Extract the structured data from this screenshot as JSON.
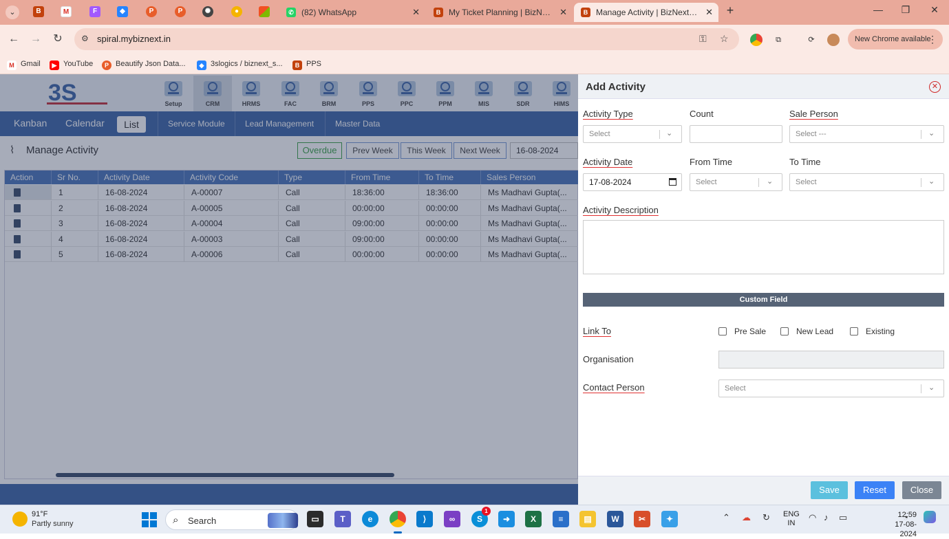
{
  "browser": {
    "tabs": [
      {
        "title": "(82) WhatsApp",
        "active": false
      },
      {
        "title": "My Ticket Planning | BizNext - A",
        "active": false
      },
      {
        "title": "Manage Activity | BizNext - An I",
        "active": true
      }
    ],
    "url": "spiral.mybiznext.in",
    "new_chrome": "New Chrome available",
    "bookmarks": [
      {
        "label": "Gmail",
        "icon": "gmail-icon",
        "color": "#d93025"
      },
      {
        "label": "YouTube",
        "icon": "youtube-icon",
        "color": "#ff0000"
      },
      {
        "label": "Beautify Json Data...",
        "icon": "p-icon",
        "color": "#e85d2a"
      },
      {
        "label": "3slogics / biznext_s...",
        "icon": "bitbucket-icon",
        "color": "#2684ff"
      },
      {
        "label": "PPS",
        "icon": "biznext-icon",
        "color": "#c2410c"
      }
    ]
  },
  "app": {
    "modules": [
      "Setup",
      "CRM",
      "HRMS",
      "FAC",
      "BRM",
      "PPS",
      "PPC",
      "PPM",
      "MIS",
      "SDR",
      "HIMS"
    ],
    "active_module": "CRM",
    "views": [
      "Kanban",
      "Calendar",
      "List"
    ],
    "active_view": "List",
    "sub_links": [
      "Service Module",
      "Lead Management",
      "Master Data"
    ],
    "page_title": "Manage Activity",
    "week_buttons": {
      "overdue": "Overdue",
      "prev": "Prev Week",
      "this": "This Week",
      "next": "Next Week"
    },
    "date_filter": "16-08-2024",
    "grid": {
      "columns": [
        "Action",
        "Sr No.",
        "Activity Date",
        "Activity Code",
        "Type",
        "From Time",
        "To Time",
        "Sales Person"
      ],
      "rows": [
        {
          "sr": "1",
          "date": "16-08-2024",
          "code": "A-00007",
          "type": "Call",
          "from": "18:36:00",
          "to": "18:36:00",
          "person": "Ms Madhavi Gupta(..."
        },
        {
          "sr": "2",
          "date": "16-08-2024",
          "code": "A-00005",
          "type": "Call",
          "from": "00:00:00",
          "to": "00:00:00",
          "person": "Ms Madhavi Gupta(..."
        },
        {
          "sr": "3",
          "date": "16-08-2024",
          "code": "A-00004",
          "type": "Call",
          "from": "09:00:00",
          "to": "00:00:00",
          "person": "Ms Madhavi Gupta(..."
        },
        {
          "sr": "4",
          "date": "16-08-2024",
          "code": "A-00003",
          "type": "Call",
          "from": "09:00:00",
          "to": "00:00:00",
          "person": "Ms Madhavi Gupta(..."
        },
        {
          "sr": "5",
          "date": "16-08-2024",
          "code": "A-00006",
          "type": "Call",
          "from": "00:00:00",
          "to": "00:00:00",
          "person": "Ms Madhavi Gupta(..."
        }
      ]
    }
  },
  "drawer": {
    "title": "Add Activity",
    "labels": {
      "activity_type": "Activity Type",
      "count": "Count",
      "sale_person": "Sale Person",
      "activity_date": "Activity Date",
      "from_time": "From Time",
      "to_time": "To Time",
      "activity_description": "Activity Description",
      "link_to": "Link To",
      "organisation": "Organisation",
      "contact_person": "Contact Person"
    },
    "values": {
      "activity_type": "Select",
      "count": "",
      "sale_person": "Select ---",
      "activity_date": "17-08-2024",
      "from_time": "Select",
      "to_time": "Select",
      "contact_person": "Select"
    },
    "custom_field": "Custom Field",
    "link_options": [
      "Pre Sale",
      "New Lead",
      "Existing"
    ],
    "buttons": {
      "save": "Save",
      "reset": "Reset",
      "close": "Close"
    },
    "colors": {
      "save": "#5bc0de",
      "reset": "#3b82f6",
      "close": "#7b8694",
      "required_underline": "#e03030"
    }
  },
  "taskbar": {
    "weather_temp": "91°F",
    "weather_desc": "Partly sunny",
    "search": "Search",
    "lang1": "ENG",
    "lang2": "IN",
    "time": "12:59",
    "date": "17-08-2024",
    "skype_badge": "1"
  }
}
